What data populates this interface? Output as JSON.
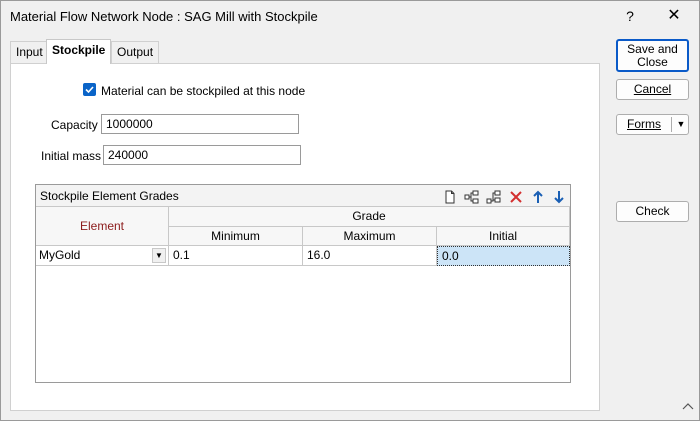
{
  "window": {
    "title": "Material Flow Network Node : SAG Mill with Stockpile",
    "help_label": "?",
    "close_label": "✕"
  },
  "tabs": [
    {
      "label": "Input",
      "active": false
    },
    {
      "label": "Stockpile",
      "active": true
    },
    {
      "label": "Output",
      "active": false
    }
  ],
  "stockpile": {
    "checkbox_label": "Material can be stockpiled at this node",
    "checkbox_checked": true,
    "capacity_label": "Capacity",
    "capacity_value": "1000000",
    "initial_mass_label": "Initial mass",
    "initial_mass_value": "240000"
  },
  "grid": {
    "title": "Stockpile Element Grades",
    "toolbar_icons": [
      "new-icon",
      "insert-row-icon",
      "append-row-icon",
      "delete-icon",
      "move-up-icon",
      "move-down-icon"
    ],
    "header_element": "Element",
    "header_grade": "Grade",
    "header_minimum": "Minimum",
    "header_maximum": "Maximum",
    "header_initial": "Initial",
    "rows": [
      {
        "element": "MyGold",
        "minimum": "0.1",
        "maximum": "16.0",
        "initial": "0.0"
      }
    ]
  },
  "buttons": {
    "save_close": "Save and Close",
    "cancel": "Cancel",
    "forms": "Forms",
    "check": "Check"
  },
  "colors": {
    "accent": "#0a64c8",
    "element_header": "#8b1a1a",
    "selection": "#cce4f7"
  }
}
